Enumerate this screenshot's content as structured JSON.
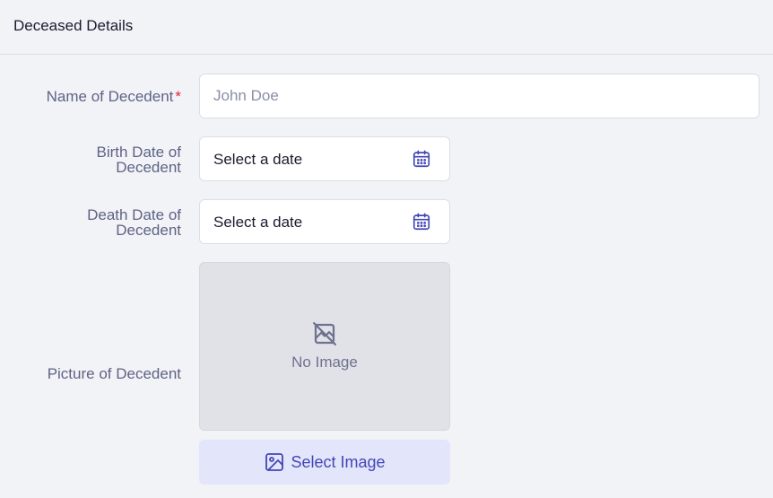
{
  "section": {
    "title": "Deceased Details"
  },
  "fields": {
    "name": {
      "label": "Name of Decedent",
      "required_mark": "*",
      "placeholder": "John Doe",
      "value": ""
    },
    "birth_date": {
      "label_line1": "Birth Date of",
      "label_line2": "Decedent",
      "value": "Select a date",
      "icon": "calendar-icon"
    },
    "death_date": {
      "label_line1": "Death Date of",
      "label_line2": "Decedent",
      "value": "Select a date",
      "icon": "calendar-icon"
    },
    "picture": {
      "label": "Picture of Decedent",
      "empty_text": "No Image",
      "empty_icon": "no-image-icon",
      "button_label": "Select Image",
      "button_icon": "image-icon"
    }
  },
  "colors": {
    "accent": "#4345b8",
    "required": "#e0283d",
    "button_bg": "#e3e6fa",
    "label": "#5e6384"
  }
}
